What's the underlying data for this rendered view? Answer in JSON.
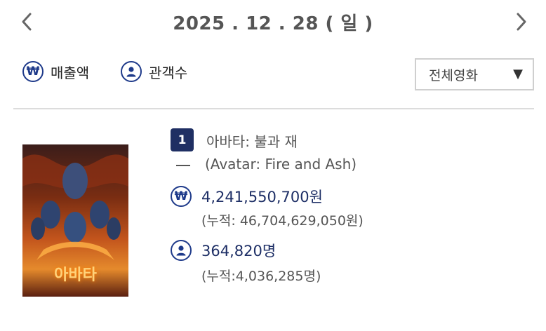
{
  "date_nav": {
    "date": "2025 . 12 . 28 ( 일 )",
    "prev_icon": "chevron-left-icon",
    "next_icon": "chevron-right-icon"
  },
  "toggles": {
    "revenue": {
      "label": "매출액",
      "icon": "won-icon"
    },
    "audience": {
      "label": "관객수",
      "icon": "person-icon"
    }
  },
  "filter": {
    "selected": "전체영화",
    "caret": "▼"
  },
  "movie": {
    "rank": "1",
    "rank_change": "—",
    "title_kr": "아바타: 불과 재",
    "title_en": "(Avatar: Fire and Ash)",
    "poster_text": "아바타",
    "revenue": "4,241,550,700원",
    "revenue_cumulative": "(누적: 46,704,629,050원)",
    "audience": "364,820명",
    "audience_cumulative": "(누적:4,036,285명)"
  },
  "colors": {
    "accent": "#1e3a8a",
    "badge": "#1f2f63",
    "text": "#333333",
    "border": "#cfcfcf"
  }
}
